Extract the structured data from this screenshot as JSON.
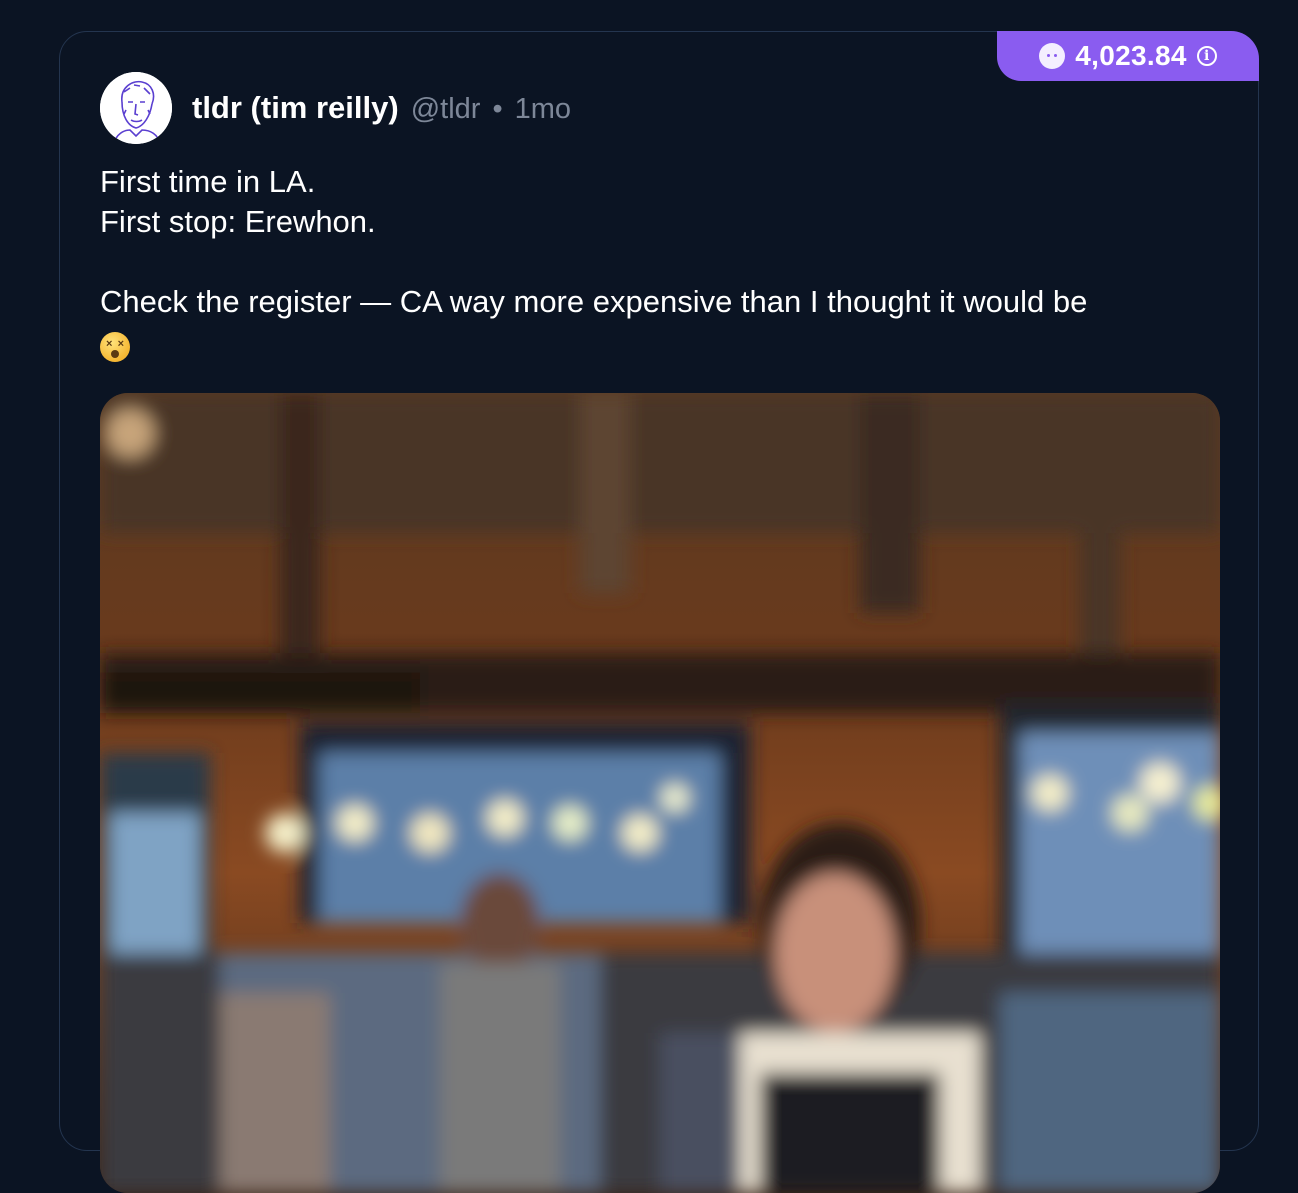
{
  "post": {
    "points": "4,023.84",
    "author": {
      "display_name": "tldr (tim reilly)",
      "handle": "@tldr",
      "separator": "•",
      "time": "1mo"
    },
    "text": {
      "line1": "First time in LA.",
      "line2": "First stop: Erewhon.",
      "line3": "Check the register — CA way more expensive than I thought it would be"
    },
    "emoji": "dizzy-face-emoji",
    "colors": {
      "background": "#0b1423",
      "points_pill": "#8a5cf0",
      "muted_text": "#7d8798"
    }
  }
}
